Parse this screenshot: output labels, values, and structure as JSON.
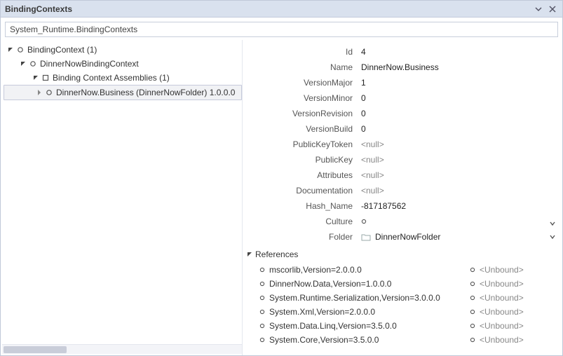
{
  "window": {
    "title": "BindingContexts"
  },
  "search": {
    "text": "System_Runtime.BindingContexts"
  },
  "tree": {
    "n0": {
      "label": "BindingContext (1)"
    },
    "n1": {
      "label": "DinnerNowBindingContext"
    },
    "n2": {
      "label": "Binding Context Assemblies (1)"
    },
    "n3": {
      "label": "DinnerNow.Business (DinnerNowFolder) 1.0.0.0"
    }
  },
  "props": {
    "labels": {
      "Id": "Id",
      "Name": "Name",
      "VersionMajor": "VersionMajor",
      "VersionMinor": "VersionMinor",
      "VersionRevision": "VersionRevision",
      "VersionBuild": "VersionBuild",
      "PublicKeyToken": "PublicKeyToken",
      "PublicKey": "PublicKey",
      "Attributes": "Attributes",
      "Documentation": "Documentation",
      "Hash_Name": "Hash_Name",
      "Culture": "Culture",
      "Folder": "Folder"
    },
    "values": {
      "Id": "4",
      "Name": "DinnerNow.Business",
      "VersionMajor": "1",
      "VersionMinor": "0",
      "VersionRevision": "0",
      "VersionBuild": "0",
      "PublicKeyToken": "<null>",
      "PublicKey": "<null>",
      "Attributes": "<null>",
      "Documentation": "<null>",
      "Hash_Name": "-817187562",
      "Culture": "",
      "Folder": "DinnerNowFolder"
    }
  },
  "refs": {
    "header": "References",
    "unbound": "<Unbound>",
    "items": [
      "mscorlib,Version=2.0.0.0",
      "DinnerNow.Data,Version=1.0.0.0",
      "System.Runtime.Serialization,Version=3.0.0.0",
      "System.Xml,Version=2.0.0.0",
      "System.Data.Linq,Version=3.5.0.0",
      "System.Core,Version=3.5.0.0"
    ]
  }
}
